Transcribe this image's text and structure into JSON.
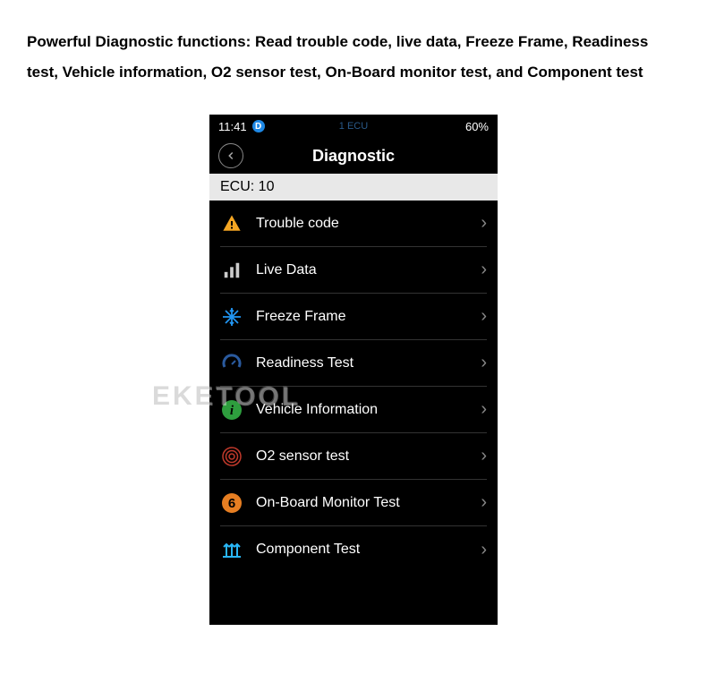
{
  "description": "Powerful Diagnostic functions: Read trouble code, live data, Freeze Frame, Readiness test, Vehicle information, O2 sensor test, On-Board monitor test, and Component test",
  "status_bar": {
    "time": "11:41",
    "indicator": "D",
    "center_text": "1 ECU",
    "battery": "60%"
  },
  "nav": {
    "title": "Diagnostic"
  },
  "section_header": "ECU: 10",
  "menu": [
    {
      "label": "Trouble code",
      "icon": "warning"
    },
    {
      "label": "Live Data",
      "icon": "bars"
    },
    {
      "label": "Freeze Frame",
      "icon": "snowflake"
    },
    {
      "label": "Readiness Test",
      "icon": "gauge"
    },
    {
      "label": "Vehicle Information",
      "icon": "info"
    },
    {
      "label": "O2 sensor test",
      "icon": "target"
    },
    {
      "label": "On-Board Monitor Test",
      "icon": "six"
    },
    {
      "label": "Component Test",
      "icon": "arrows"
    }
  ],
  "watermark": "EKETOOL"
}
